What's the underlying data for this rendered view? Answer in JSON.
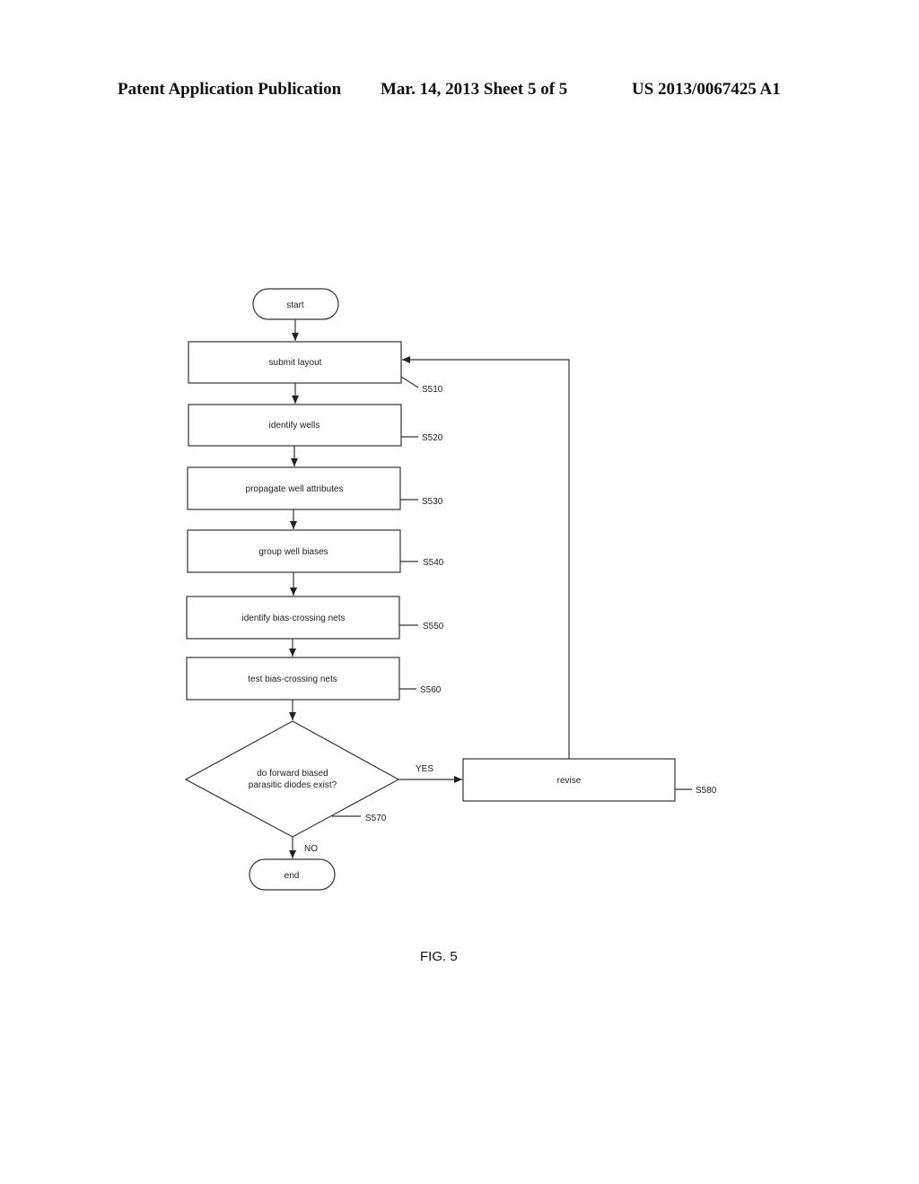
{
  "header": {
    "left": "Patent Application Publication",
    "center": "Mar. 14, 2013  Sheet 5 of 5",
    "right": "US 2013/0067425 A1"
  },
  "flowchart": {
    "start": "start",
    "end": "end",
    "steps": [
      {
        "id": "S510",
        "label": "submit layout"
      },
      {
        "id": "S520",
        "label": "identify wells"
      },
      {
        "id": "S530",
        "label": "propagate well attributes"
      },
      {
        "id": "S540",
        "label": "group well biases"
      },
      {
        "id": "S550",
        "label": "identify bias-crossing nets"
      },
      {
        "id": "S560",
        "label": "test bias-crossing nets"
      }
    ],
    "decision": {
      "id": "S570",
      "line1": "do forward biased",
      "line2": "parasitic diodes exist?",
      "yes_label": "YES",
      "no_label": "NO"
    },
    "revise": {
      "id": "S580",
      "label": "revise"
    }
  },
  "figure_label": "FIG. 5"
}
